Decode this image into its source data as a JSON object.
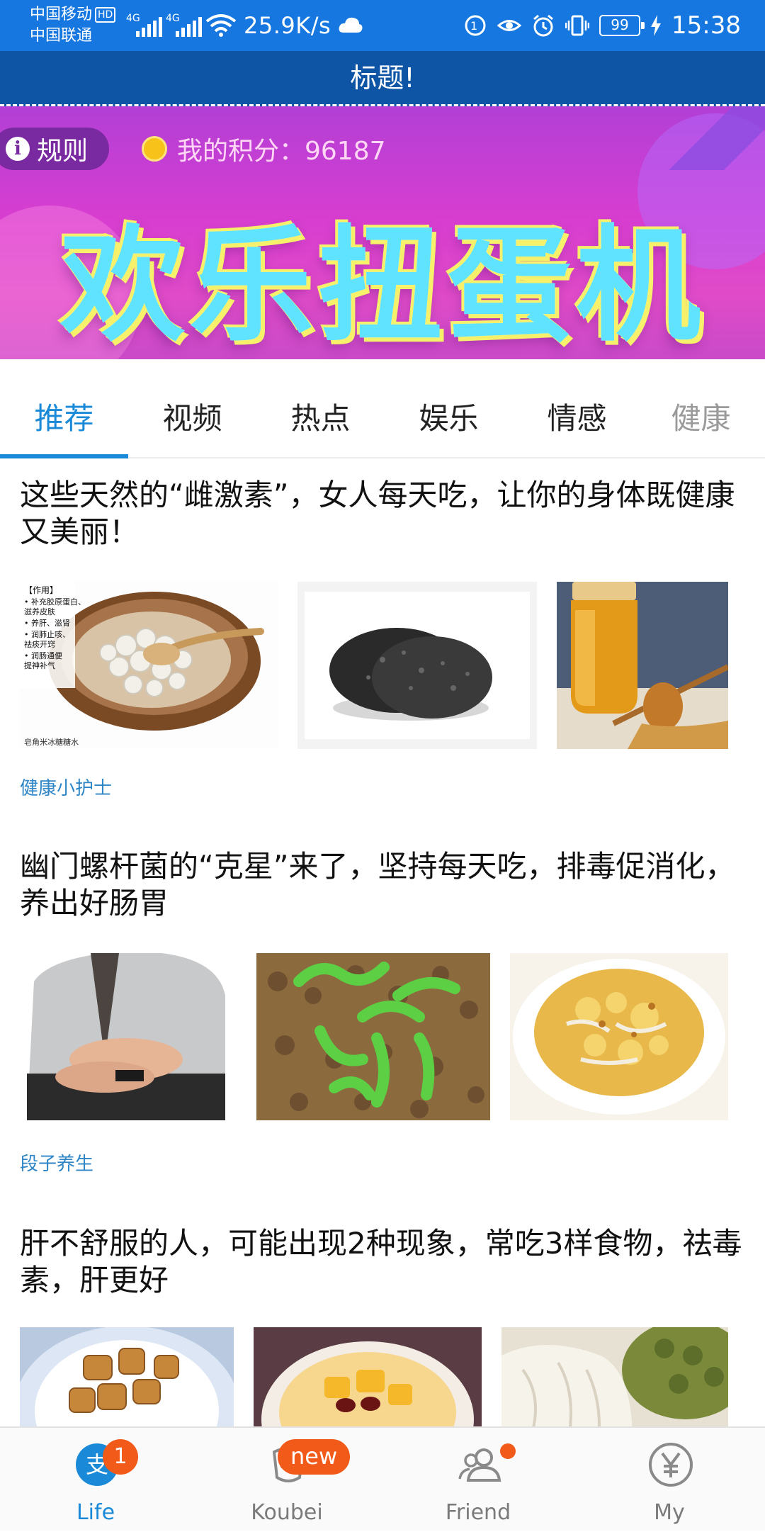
{
  "status_bar": {
    "carrier_1": "中国移动",
    "carrier_1_badge": "HD",
    "carrier_2": "中国联通",
    "network_tag_1": "4G",
    "network_tag_2": "4G",
    "speed": "25.9K/s",
    "battery": "99",
    "time": "15:38",
    "icons": [
      "signal-icon",
      "wifi-icon",
      "cloud-icon",
      "sync-icon",
      "eye-icon",
      "alarm-icon",
      "vibrate-icon",
      "battery-icon",
      "charging-icon"
    ]
  },
  "title_bar": {
    "title": "标题!"
  },
  "banner": {
    "rules_label": "规则",
    "points_label": "我的积分：96187",
    "title": "欢乐扭蛋机"
  },
  "tabs": [
    {
      "label": "推荐",
      "active": true
    },
    {
      "label": "视频"
    },
    {
      "label": "热点"
    },
    {
      "label": "娱乐"
    },
    {
      "label": "情感"
    },
    {
      "label": "健康"
    }
  ],
  "articles": [
    {
      "title": "这些天然的“雌激素”，女人每天吃，让你的身体既健康又美丽！",
      "source": "健康小护士",
      "image_1_caption": "【作用】\n• 补充胶原蛋白、\n  滋养皮肤\n• 养肝、滋肾\n• 润肺止咳、\n  祛痰开窍\n• 润肠通便\n  提神补气",
      "image_1_footer": "皂角米冰糖糖水",
      "images": [
        "tremella-soup-image",
        "black-sesame-cake-image",
        "honey-jar-image"
      ]
    },
    {
      "title": "幽门螺杆菌的“克星”来了，坚持每天吃，排毒促消化，养出好肠胃",
      "source": "段子养生",
      "images": [
        "stomach-ache-image",
        "bacteria-image",
        "fried-egg-dish-image"
      ]
    },
    {
      "title": "肝不舒服的人，可能出现2种现象，常吃3样食物，祛毒素，肝更好",
      "source": "",
      "images": [
        "fried-yam-image",
        "fruit-soup-image",
        "white-fruit-image"
      ]
    }
  ],
  "bottom_nav": [
    {
      "label": "Life",
      "badge": "1",
      "icon": "alipay-icon",
      "active": true
    },
    {
      "label": "Koubei",
      "badge": "new",
      "icon": "koubei-icon"
    },
    {
      "label": "Friend",
      "badge_dot": true,
      "icon": "friends-icon"
    },
    {
      "label": "My",
      "icon": "yuan-icon"
    }
  ],
  "colors": {
    "status_bar": "#1677e0",
    "title_bar": "#0e55a6",
    "accent": "#1a8ad8",
    "badge": "#f25a1a",
    "source_text": "#2f86c6"
  }
}
